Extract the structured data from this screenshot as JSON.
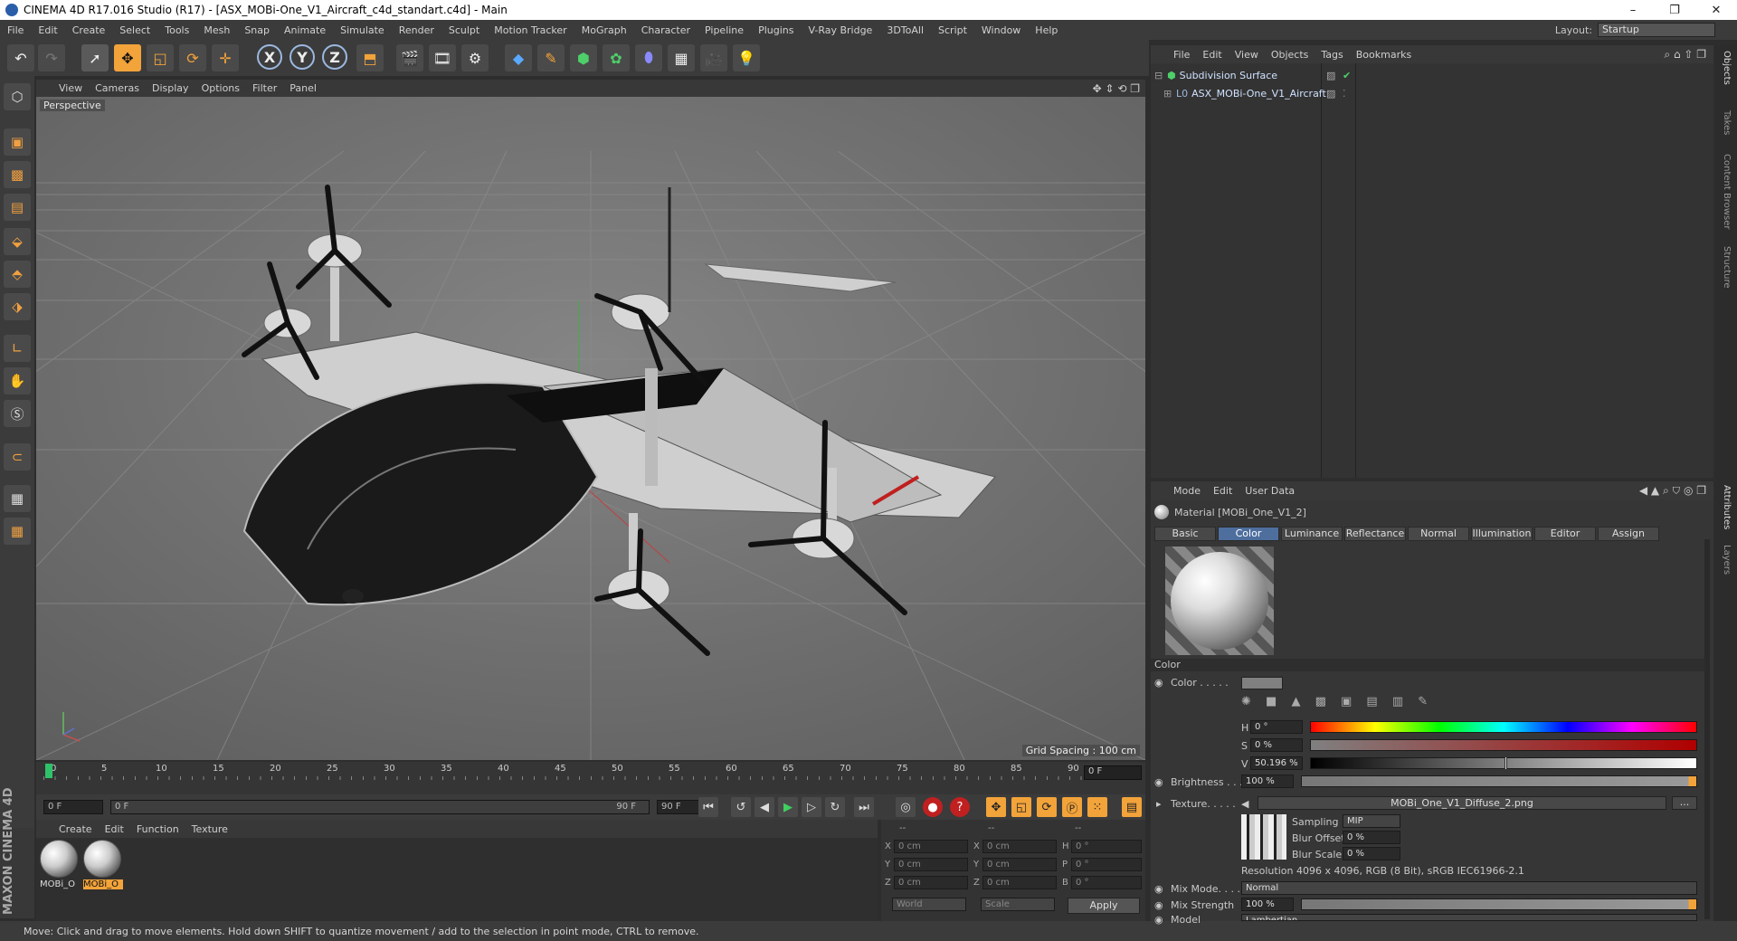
{
  "window": {
    "title": "CINEMA 4D R17.016 Studio (R17) - [ASX_MOBi-One_V1_Aircraft_c4d_standart.c4d] - Main",
    "controls": [
      "–",
      "❐",
      "✕"
    ]
  },
  "menubar": {
    "items": [
      "File",
      "Edit",
      "Create",
      "Select",
      "Tools",
      "Mesh",
      "Snap",
      "Animate",
      "Simulate",
      "Render",
      "Sculpt",
      "Motion Tracker",
      "MoGraph",
      "Character",
      "Pipeline",
      "Plugins",
      "V-Ray Bridge",
      "3DToAll",
      "Script",
      "Window",
      "Help"
    ],
    "layout_label": "Layout:",
    "layout_value": "Startup"
  },
  "toolbar": {
    "axis_x": "X",
    "axis_y": "Y",
    "axis_z": "Z"
  },
  "viewport": {
    "menu": [
      "View",
      "Cameras",
      "Display",
      "Options",
      "Filter",
      "Panel"
    ],
    "label": "Perspective",
    "grid_spacing": "Grid Spacing : 100 cm"
  },
  "timeline": {
    "ticks": [
      "0",
      "5",
      "10",
      "15",
      "20",
      "25",
      "30",
      "35",
      "40",
      "45",
      "50",
      "55",
      "60",
      "65",
      "70",
      "75",
      "80",
      "85",
      "90"
    ],
    "frame": "0 F",
    "start": "0 F",
    "range_start": "0 F",
    "range_end": "90 F",
    "end": "90 F"
  },
  "material_manager": {
    "menu": [
      "Create",
      "Edit",
      "Function",
      "Texture"
    ],
    "materials": [
      {
        "name": "MOBi_O",
        "selected": false
      },
      {
        "name": "MOBi_O",
        "selected": true
      }
    ]
  },
  "coordinates": {
    "headers": [
      "--",
      "--",
      "--"
    ],
    "rows": [
      {
        "a": "X",
        "av": "0 cm",
        "b": "X",
        "bv": "0 cm",
        "c": "H",
        "cv": "0 °"
      },
      {
        "a": "Y",
        "av": "0 cm",
        "b": "Y",
        "bv": "0 cm",
        "c": "P",
        "cv": "0 °"
      },
      {
        "a": "Z",
        "av": "0 cm",
        "b": "Z",
        "bv": "0 cm",
        "c": "B",
        "cv": "0 °"
      }
    ],
    "mode1": "World",
    "mode2": "Scale",
    "apply": "Apply"
  },
  "status": "Move: Click and drag to move elements. Hold down SHIFT to quantize movement / add to the selection in point mode, CTRL to remove.",
  "maxon": "MAXON CINEMA 4D",
  "objects": {
    "menu": [
      "File",
      "Edit",
      "View",
      "Objects",
      "Tags",
      "Bookmarks"
    ],
    "items": [
      {
        "name": "Subdivision Surface"
      },
      {
        "name": "ASX_MOBi-One_V1_Aircraft"
      }
    ]
  },
  "attributes": {
    "menu": [
      "Mode",
      "Edit",
      "User Data"
    ],
    "material_title": "Material [MOBi_One_V1_2]",
    "tabs": [
      "Basic",
      "Color",
      "Luminance",
      "Reflectance",
      "Normal",
      "Illumination",
      "Editor",
      "Assign"
    ],
    "active_tab": "Color",
    "section": "Color",
    "color_label": "Color . . . . .",
    "h_label": "H",
    "h_value": "0 °",
    "s_label": "S",
    "s_value": "0 %",
    "v_label": "V",
    "v_value": "50.196 %",
    "v_fraction": 0.50196,
    "brightness_label": "Brightness . . .",
    "brightness_value": "100 %",
    "texture_label": "Texture. . . . .",
    "texture_file": "MOBi_One_V1_Diffuse_2.png",
    "texture_more": "...",
    "sampling_label": "Sampling",
    "sampling_value": "MIP",
    "blur_offset_label": "Blur Offset",
    "blur_offset_value": "0 %",
    "blur_scale_label": "Blur Scale",
    "blur_scale_value": "0 %",
    "resolution": "Resolution 4096 x 4096, RGB (8 Bit), sRGB IEC61966-2.1",
    "mix_mode_label": "Mix Mode. . . .",
    "mix_mode_value": "Normal",
    "mix_strength_label": "Mix Strength",
    "mix_strength_value": "100 %",
    "model_label": "Model",
    "model_value": "Lambertian"
  },
  "side_tabs": [
    "Objects",
    "Takes",
    "Content Browser",
    "Structure"
  ],
  "side_tabs_lower": [
    "Attributes",
    "Layers"
  ],
  "colors": {
    "accent": "#f2a33a",
    "tab_active": "#4e6f9e",
    "playhead": "#2ec36a"
  }
}
